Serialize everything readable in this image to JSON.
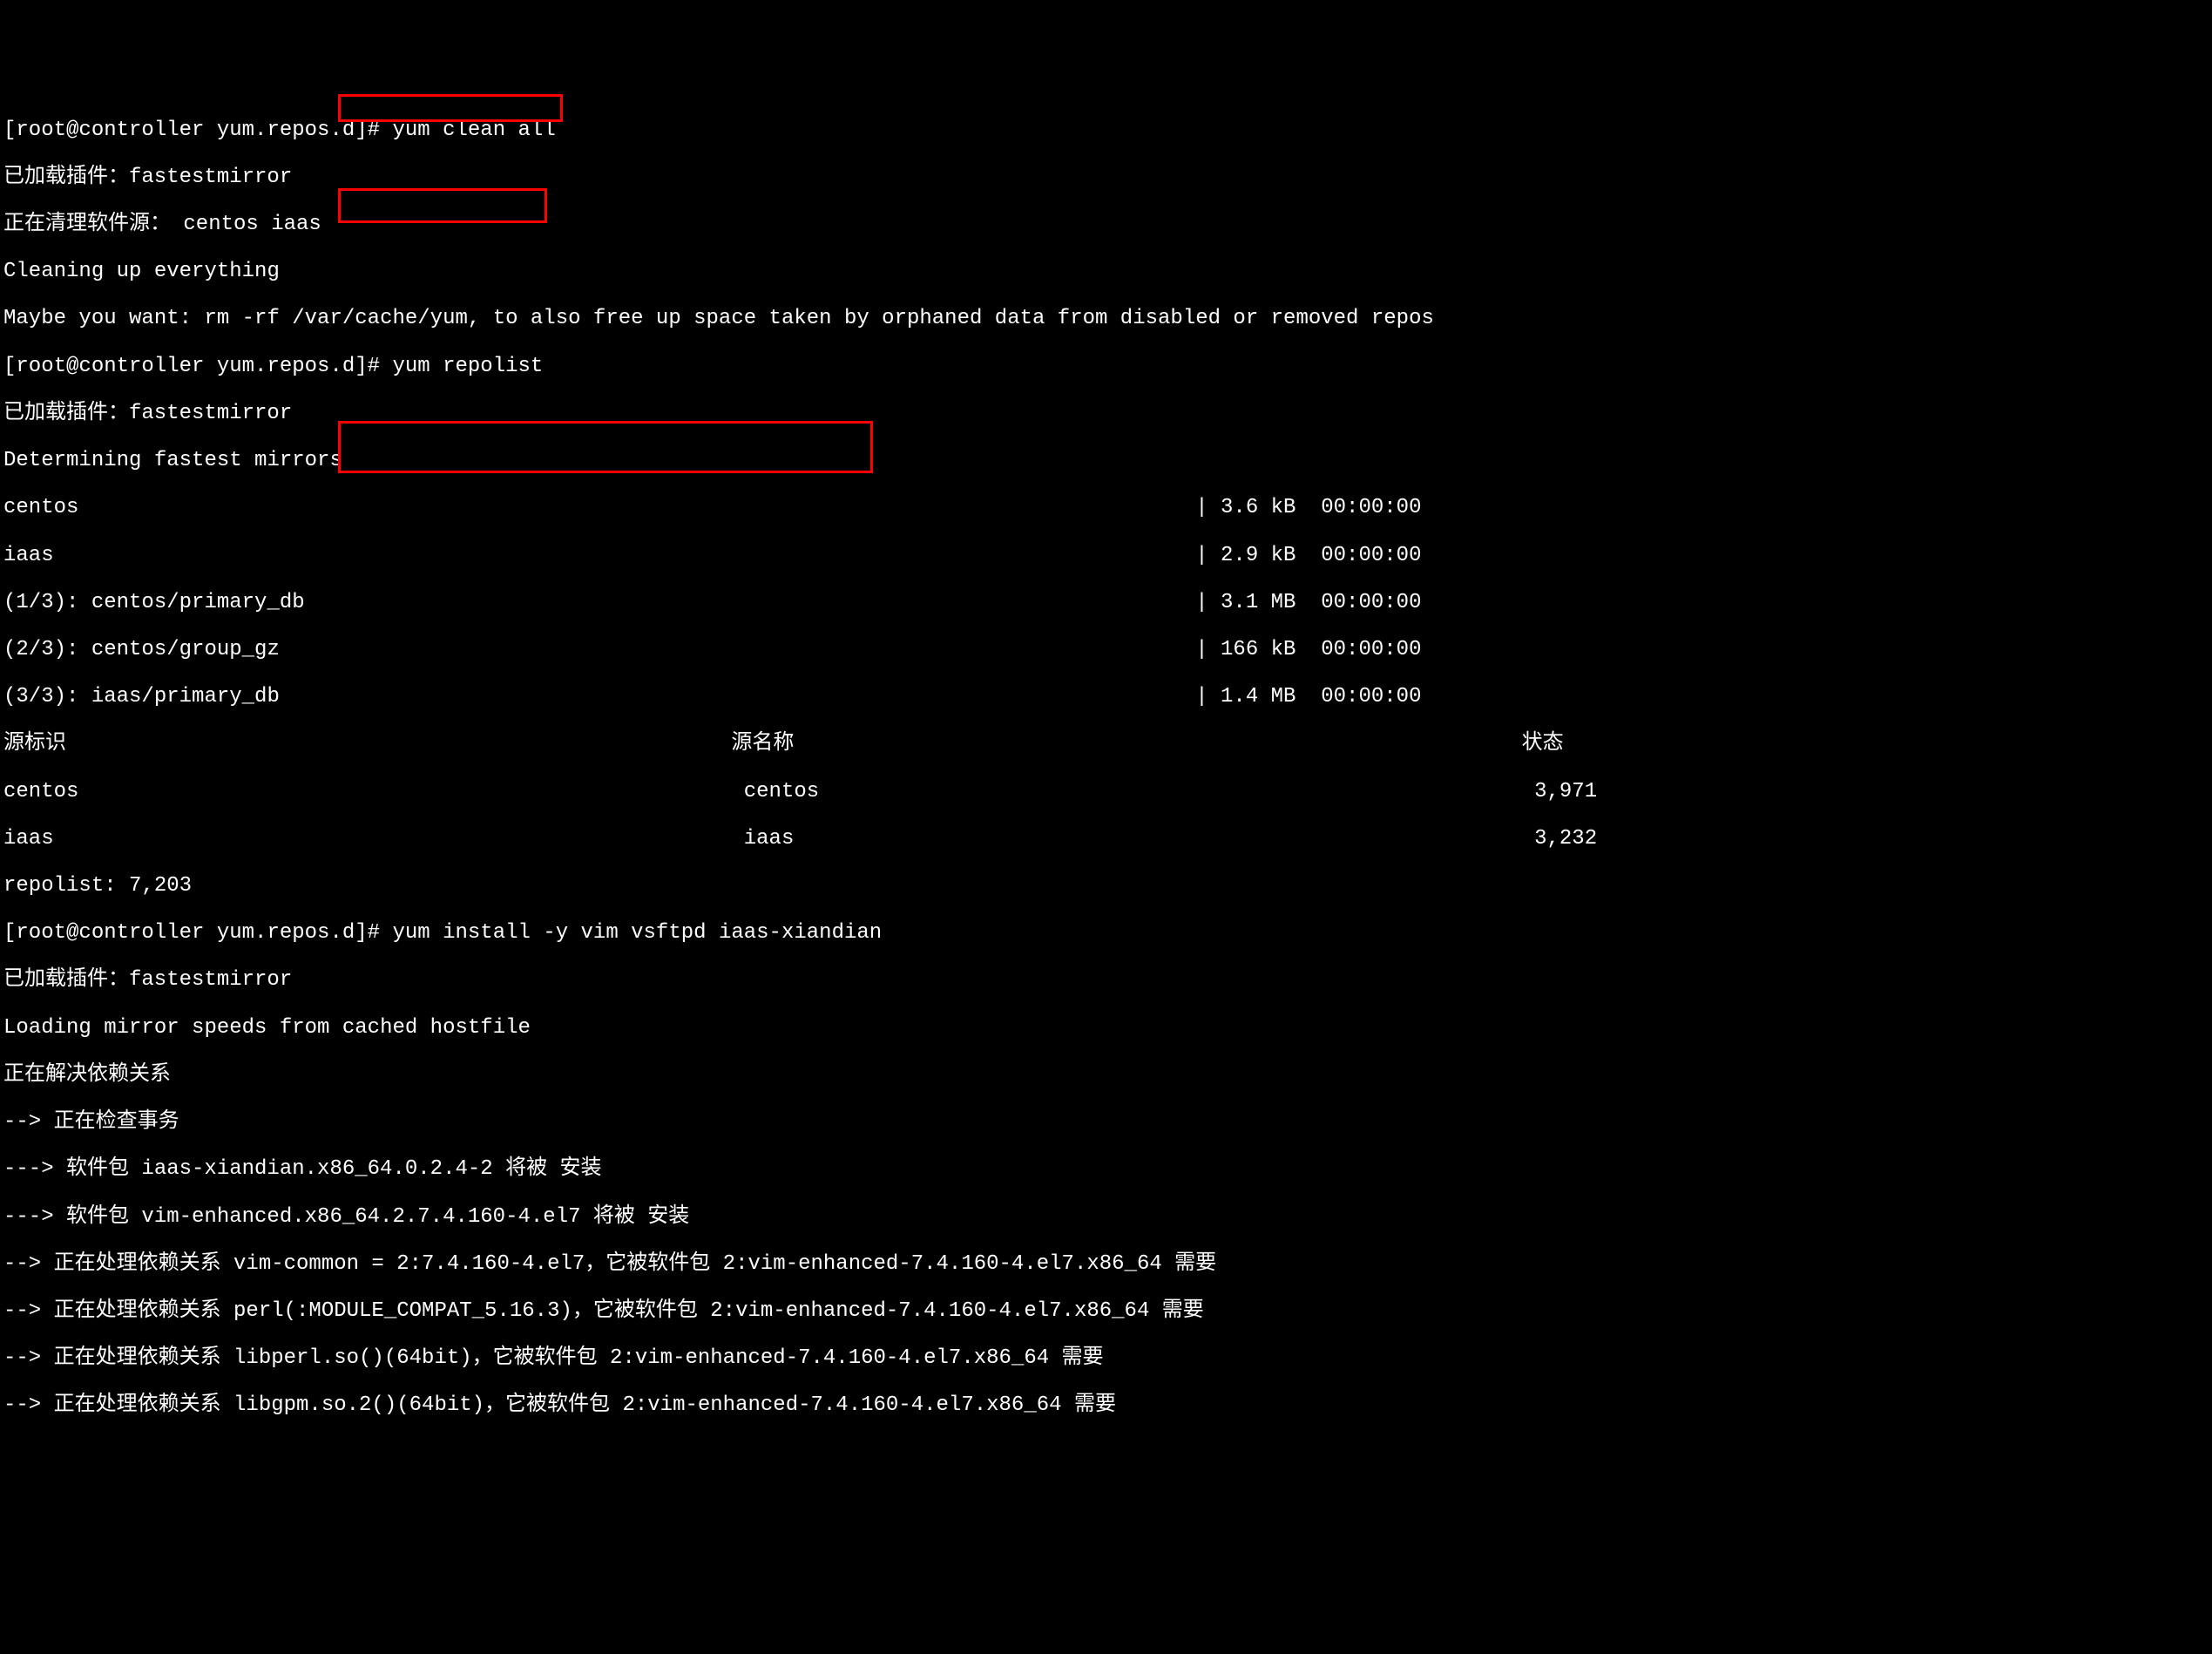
{
  "prompt1": "[root@controller yum.repos.d]# ",
  "cmd1": "yum clean all",
  "line2": "已加载插件：fastestmirror",
  "line3": "正在清理软件源： centos iaas",
  "line4": "Cleaning up everything",
  "line5": "Maybe you want: rm -rf /var/cache/yum, to also free up space taken by orphaned data from disabled or removed repos",
  "prompt2": "[root@controller yum.repos.d]# ",
  "cmd2": "yum repolist",
  "line7": "已加载插件：fastestmirror",
  "line8": "Determining fastest mirrors",
  "line9": "centos                                                                                         | 3.6 kB  00:00:00",
  "line10": "iaas                                                                                           | 2.9 kB  00:00:00",
  "line11": "(1/3): centos/primary_db                                                                       | 3.1 MB  00:00:00",
  "line12": "(2/3): centos/group_gz                                                                         | 166 kB  00:00:00",
  "line13": "(3/3): iaas/primary_db                                                                         | 1.4 MB  00:00:00",
  "line14": "源标识                                                     源名称                                                          状态",
  "line15": "centos                                                     centos                                                         3,971",
  "line16": "iaas                                                       iaas                                                           3,232",
  "line17": "repolist: 7,203",
  "prompt3": "[root@controller yum.repos.d]# ",
  "cmd3": "yum install -y vim vsftpd iaas-xiandian",
  "line19": "已加载插件：fastestmirror",
  "line20": "Loading mirror speeds from cached hostfile",
  "line21": "正在解决依赖关系",
  "line22": "--> 正在检查事务",
  "line23": "---> 软件包 iaas-xiandian.x86_64.0.2.4-2 将被 安装",
  "line24": "---> 软件包 vim-enhanced.x86_64.2.7.4.160-4.el7 将被 安装",
  "line25": "--> 正在处理依赖关系 vim-common = 2:7.4.160-4.el7，它被软件包 2:vim-enhanced-7.4.160-4.el7.x86_64 需要",
  "line26": "--> 正在处理依赖关系 perl(:MODULE_COMPAT_5.16.3)，它被软件包 2:vim-enhanced-7.4.160-4.el7.x86_64 需要",
  "line27": "--> 正在处理依赖关系 libperl.so()(64bit)，它被软件包 2:vim-enhanced-7.4.160-4.el7.x86_64 需要",
  "line28": "--> 正在处理依赖关系 libgpm.so.2()(64bit)，它被软件包 2:vim-enhanced-7.4.160-4.el7.x86_64 需要"
}
